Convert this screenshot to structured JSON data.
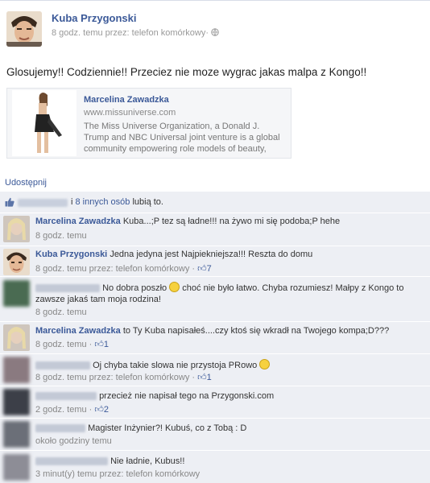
{
  "post": {
    "author": "Kuba Przygonski",
    "meta": "8 godz. temu przez: telefon komórkowy",
    "meta_sep": "·",
    "status_text": "Glosujemy!! Codziennie!! Przeciez nie moze wygrac jakas malpa z Kongo!!"
  },
  "link_preview": {
    "title": "Marcelina Zawadzka",
    "url": "www.missuniverse.com",
    "description": "The Miss Universe Organization, a Donald J. Trump and NBC Universal joint venture is a global community empowering role models of beauty,"
  },
  "share_label": "Udostępnij",
  "likes": {
    "others_link": "8 innych osób",
    "suffix": "lubią to."
  },
  "comments": [
    {
      "name": "Marcelina Zawadzka",
      "text": "Kuba...;P tez są ładne!!! na żywo mi się podoba;P hehe",
      "meta": "8 godz. temu",
      "likes": ""
    },
    {
      "name": "Kuba Przygonski",
      "text": "Jedna jedyna jest Najpiekniejsza!!! Reszta do domu",
      "meta": "8 godz. temu przez: telefon komórkowy ·",
      "likes": "7"
    },
    {
      "name": "",
      "text": "No dobra poszło",
      "text2": "choć nie było łatwo. Chyba rozumiesz! Małpy z Kongo to",
      "text3": "zawsze jakaś tam moja rodzina!",
      "meta": "8 godz. temu",
      "likes": ""
    },
    {
      "name": "Marcelina Zawadzka",
      "text": "to Ty Kuba napisałeś....czy ktoś się wkradł na Twojego kompa;D???",
      "meta": "8 godz. temu ·",
      "likes": "1"
    },
    {
      "name": "",
      "text": "Oj chyba takie slowa nie przystoja PRowo",
      "meta": "8 godz. temu przez: telefon komórkowy ·",
      "likes": "1"
    },
    {
      "name": "",
      "text": "przecież nie napisał tego na Przygonski.com",
      "meta": "2 godz. temu ·",
      "likes": "2"
    },
    {
      "name": "",
      "text": "Magister Inżynier?! Kubuś, co z Tobą : D",
      "meta": "około godziny temu",
      "likes": ""
    },
    {
      "name": "",
      "text": "Nie ładnie, Kubus!!",
      "meta": "3 minut(y) temu przez: telefon komórkowy",
      "likes": ""
    }
  ],
  "colors": {
    "link": "#3b5998",
    "comments_bg": "#edeff4",
    "meta_gray": "#888888"
  }
}
